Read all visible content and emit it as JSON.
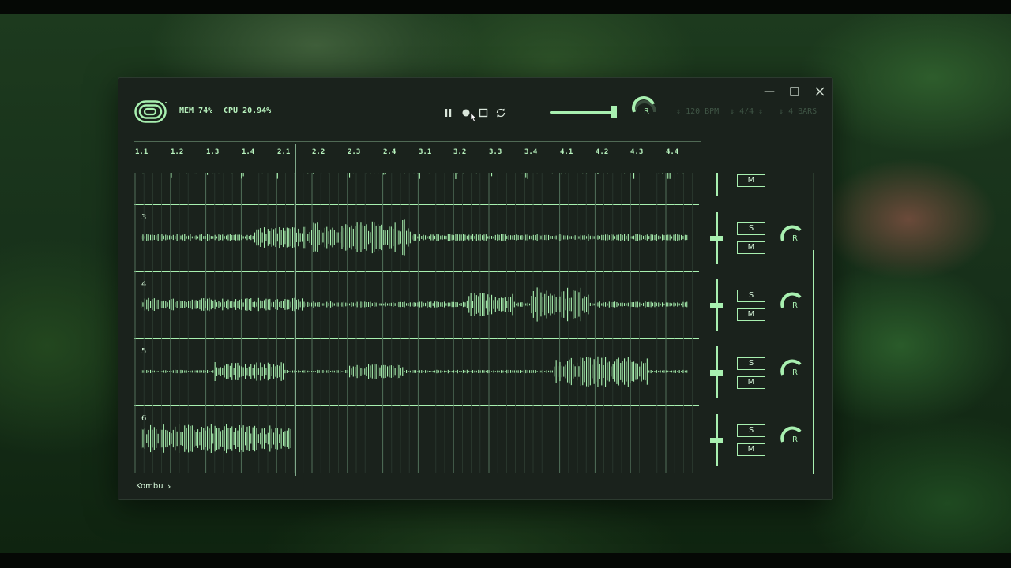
{
  "window": {
    "minimize_icon": "minimize-icon",
    "maximize_icon": "maximize-icon",
    "close_icon": "close-icon"
  },
  "header": {
    "mem": "MEM 74%",
    "cpu": "CPU 20.94%",
    "params": {
      "bpm": "120 BPM",
      "signature": "4/4",
      "bars": "4 BARS"
    },
    "master_knob_label": "R",
    "volume_level": 0.95
  },
  "transport": {
    "icons": [
      "pause-icon",
      "record-icon",
      "stop-icon",
      "loop-icon"
    ]
  },
  "ruler": {
    "ticks": [
      "1.1",
      "1.2",
      "1.3",
      "1.4",
      "2.1",
      "2.2",
      "2.3",
      "2.4",
      "3.1",
      "3.2",
      "3.3",
      "3.4",
      "4.1",
      "4.2",
      "4.3",
      "4.4"
    ]
  },
  "tracks": [
    {
      "number": "",
      "solo": "",
      "mute": "M",
      "knob": "",
      "partial": true
    },
    {
      "number": "3",
      "solo": "S",
      "mute": "M",
      "knob": "R"
    },
    {
      "number": "4",
      "solo": "S",
      "mute": "M",
      "knob": "R"
    },
    {
      "number": "5",
      "solo": "S",
      "mute": "M",
      "knob": "R"
    },
    {
      "number": "6",
      "solo": "S",
      "mute": "M",
      "knob": "R"
    }
  ],
  "footer": {
    "breadcrumb": "Kombu"
  },
  "colors": {
    "accent": "#a8f0b0",
    "window_bg": "#1a221c",
    "muted": "#3f5545"
  }
}
